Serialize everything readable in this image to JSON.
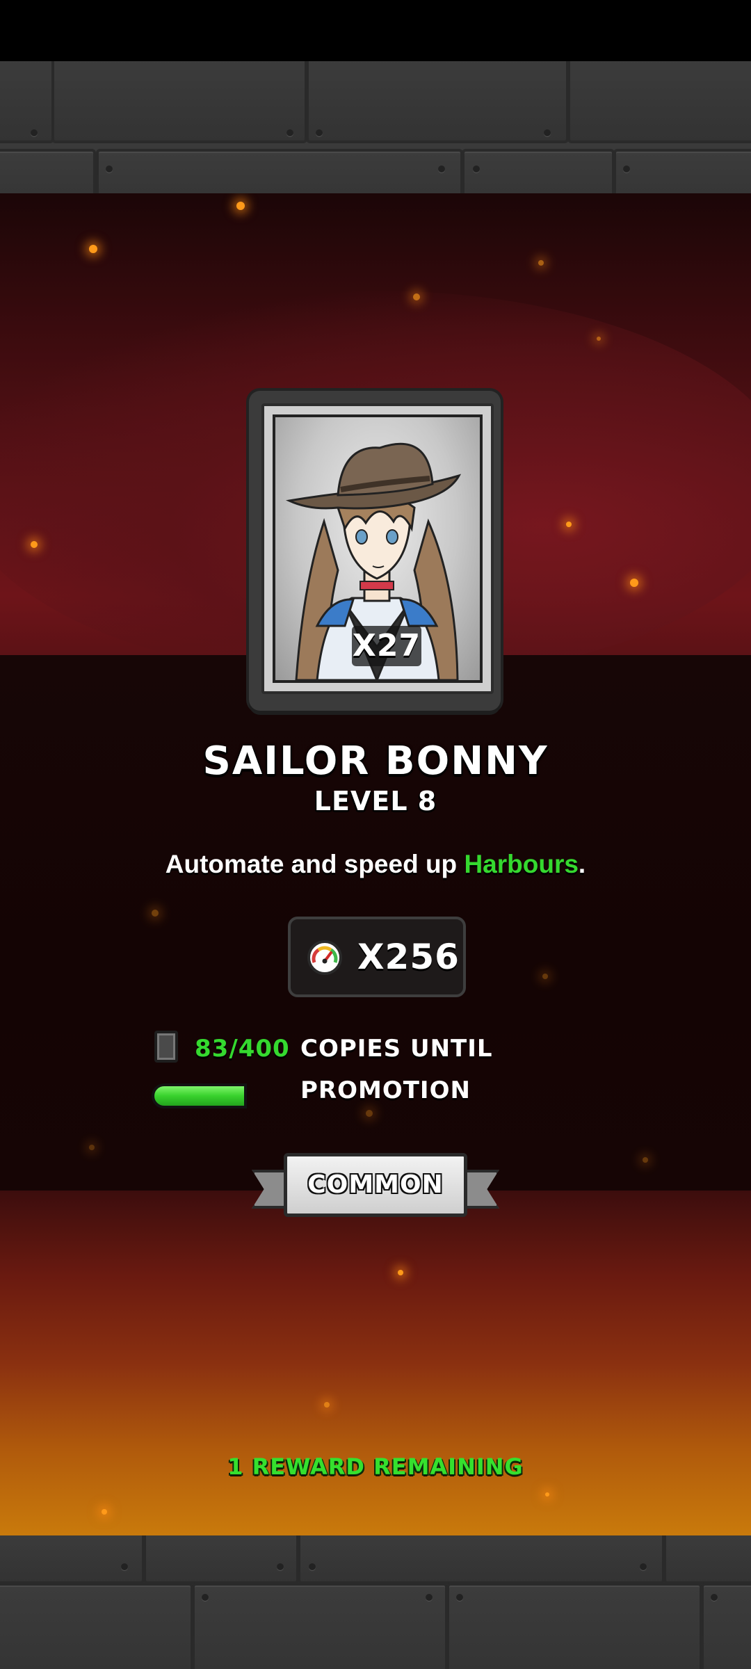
{
  "reward": {
    "card_count": "X27",
    "name": "SAILOR BONNY",
    "level": "LEVEL 8",
    "description": {
      "prefix": "Automate and speed up ",
      "highlight": "Harbours",
      "suffix": "."
    },
    "multiplier": "X256",
    "copies_count": "83/400",
    "copies_label": "COPIES UNTIL PROMOTION",
    "progress_fraction": 0.2075,
    "rarity": "COMMON",
    "remaining": "1 REWARD REMAINING"
  },
  "icons": {
    "speed": "speed-gauge-icon",
    "card": "card-copies-icon"
  },
  "colors": {
    "highlight_green": "#35d92f",
    "progress_green": "#38d12d"
  }
}
